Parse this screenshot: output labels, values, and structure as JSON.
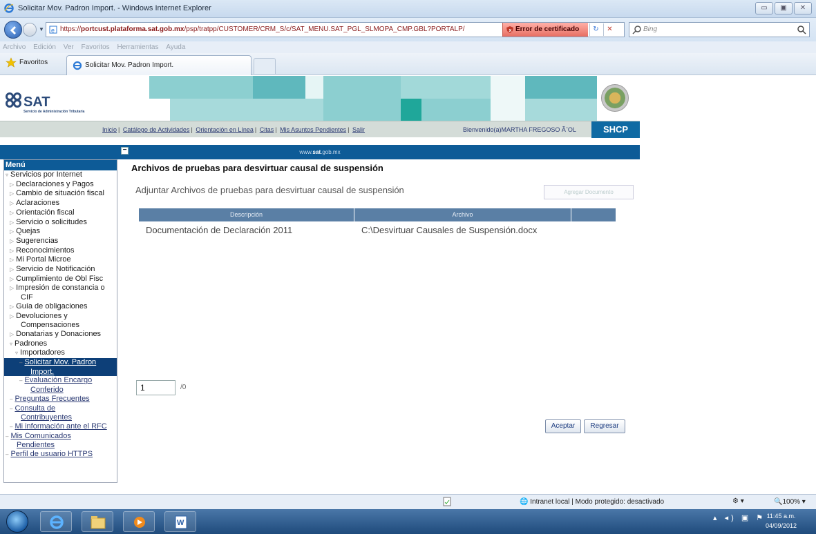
{
  "browser": {
    "window_title": "Solicitar Mov. Padron Import. - Windows Internet Explorer",
    "url_prefix": "https://",
    "url_host": "portcust.plataforma.sat.gob.mx",
    "url_path": "/psp/tratpp/CUSTOMER/CRM_S/c/SAT_MENU.SAT_PGL_SLMOPA_CMP.GBL?PORTALP/",
    "cert_error": "Error de certificado",
    "search_placeholder": "Bing",
    "menu": [
      "Archivo",
      "Edición",
      "Ver",
      "Favoritos",
      "Herramientas",
      "Ayuda"
    ],
    "favorites_label": "Favoritos",
    "tab_label": "Solicitar Mov. Padron Import."
  },
  "site": {
    "logo_text": "SAT",
    "logo_subtitle": "Servicio de Administración Tributaria",
    "links": [
      "Inicio",
      "Catálogo de Actividades",
      "Orientación en Línea",
      "Citas",
      "Mis Asuntos Pendientes",
      "Salir"
    ],
    "welcome": "Bienvenido(a)MARTHA FREGOSO Ã¨OL",
    "shcp": "SHCP",
    "url_bar_pre": "www.",
    "url_bar_bold": "sat",
    "url_bar_post": ".gob.mx"
  },
  "menu": {
    "title": "Menú",
    "items": [
      {
        "label": "Servicios por Internet",
        "level": "l0",
        "arrow": "▿"
      },
      {
        "label": "Declaraciones y Pagos",
        "level": "l1",
        "arrow": "▷"
      },
      {
        "label": "Cambio de situación fiscal",
        "level": "l1",
        "arrow": "▷"
      },
      {
        "label": "Aclaraciones",
        "level": "l1",
        "arrow": "▷"
      },
      {
        "label": "Orientación fiscal",
        "level": "l1",
        "arrow": "▷"
      },
      {
        "label": "Servicio o solicitudes",
        "level": "l1",
        "arrow": "▷"
      },
      {
        "label": "Quejas",
        "level": "l1",
        "arrow": "▷"
      },
      {
        "label": "Sugerencias",
        "level": "l1",
        "arrow": "▷"
      },
      {
        "label": "Reconocimientos",
        "level": "l1",
        "arrow": "▷"
      },
      {
        "label": "Mi Portal Microe",
        "level": "l1",
        "arrow": "▷"
      },
      {
        "label": "Servicio de Notificación",
        "level": "l1",
        "arrow": "▷"
      },
      {
        "label": "Cumplimiento de Obl Fisc",
        "level": "l1",
        "arrow": "▷"
      },
      {
        "label": "Impresión de constancia o",
        "level": "l1",
        "arrow": "▷"
      },
      {
        "label": "CIF",
        "level": "l1",
        "arrow": "",
        "cont": true
      },
      {
        "label": "Guía de obligaciones",
        "level": "l1",
        "arrow": "▷"
      },
      {
        "label": "Devoluciones y",
        "level": "l1",
        "arrow": "▷"
      },
      {
        "label": "Compensaciones",
        "level": "l1",
        "arrow": "",
        "cont": true
      },
      {
        "label": "Donatarias y Donaciones",
        "level": "l1",
        "arrow": "▷"
      },
      {
        "label": "Padrones",
        "level": "l1",
        "arrow": "▿"
      },
      {
        "label": "Importadores",
        "level": "l2",
        "arrow": "▿"
      },
      {
        "label": "Solicitar Mov. Padron",
        "level": "l3",
        "arrow": "–",
        "link": true,
        "selected": true
      },
      {
        "label": "Import.",
        "level": "l3",
        "arrow": "",
        "link": true,
        "selected": true,
        "cont": true
      },
      {
        "label": "Evaluación Encargo",
        "level": "l3",
        "arrow": "–",
        "link": true
      },
      {
        "label": "Conferido",
        "level": "l3",
        "arrow": "",
        "link": true,
        "cont": true
      },
      {
        "label": "Preguntas Frecuentes",
        "level": "l1",
        "arrow": "–",
        "link": true
      },
      {
        "label": "Consulta de",
        "level": "l1",
        "arrow": "–",
        "link": true
      },
      {
        "label": "Contribuyentes",
        "level": "l1",
        "arrow": "",
        "link": true,
        "cont": true
      },
      {
        "label": "Mi información ante el RFC",
        "level": "l1",
        "arrow": "–",
        "link": true
      },
      {
        "label": "Mis Comunicados",
        "level": "l0",
        "arrow": "–",
        "link": true
      },
      {
        "label": "Pendientes",
        "level": "l0",
        "arrow": "",
        "link": true,
        "cont": true
      },
      {
        "label": "Perfil de usuario HTTPS",
        "level": "l0",
        "arrow": "–",
        "link": true
      }
    ]
  },
  "content": {
    "title": "Archivos de pruebas para desvirtuar causal de suspensión",
    "subtitle": "Adjuntar Archivos de pruebas para desvirtuar causal de suspensión",
    "add_document": "Agregar Documento",
    "columns": [
      "Descripción",
      "Archivo"
    ],
    "rows": [
      {
        "descripcion": "Documentación de Declaración 2011",
        "archivo": "C:\\Desvirtuar Causales de Suspensión.docx"
      }
    ],
    "page_value": "1",
    "page_suffix": "/0",
    "accept": "Aceptar",
    "back": "Regresar"
  },
  "status": {
    "zone": "Intranet local | Modo protegido: desactivado",
    "zoom": "100%"
  },
  "taskbar": {
    "time": "11:45 a.m.",
    "date": "04/09/2012"
  },
  "colors": {
    "sat_blue": "#0d5b97",
    "table_header": "#5a7fa5",
    "teal": "#7fc7cc"
  }
}
